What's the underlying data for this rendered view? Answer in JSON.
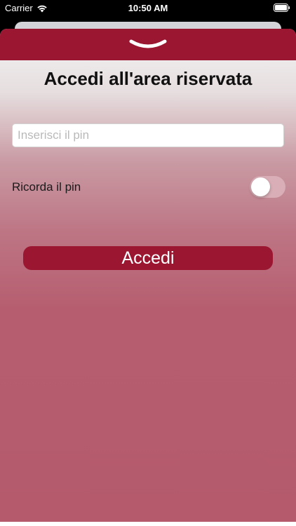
{
  "status_bar": {
    "carrier": "Carrier",
    "time": "10:50 AM",
    "wifi_icon": "wifi-icon",
    "battery_icon": "battery-icon"
  },
  "sheet": {
    "header_color": "#9b1631",
    "dismiss_icon": "chevron-down-icon"
  },
  "login": {
    "title": "Accedi all'area riservata",
    "pin_placeholder": "Inserisci il pin",
    "pin_value": "",
    "remember_label": "Ricorda il pin",
    "remember_enabled": false,
    "submit_label": "Accedi"
  },
  "colors": {
    "accent": "#9b1631",
    "gradient_bottom": "#b45a6c"
  }
}
